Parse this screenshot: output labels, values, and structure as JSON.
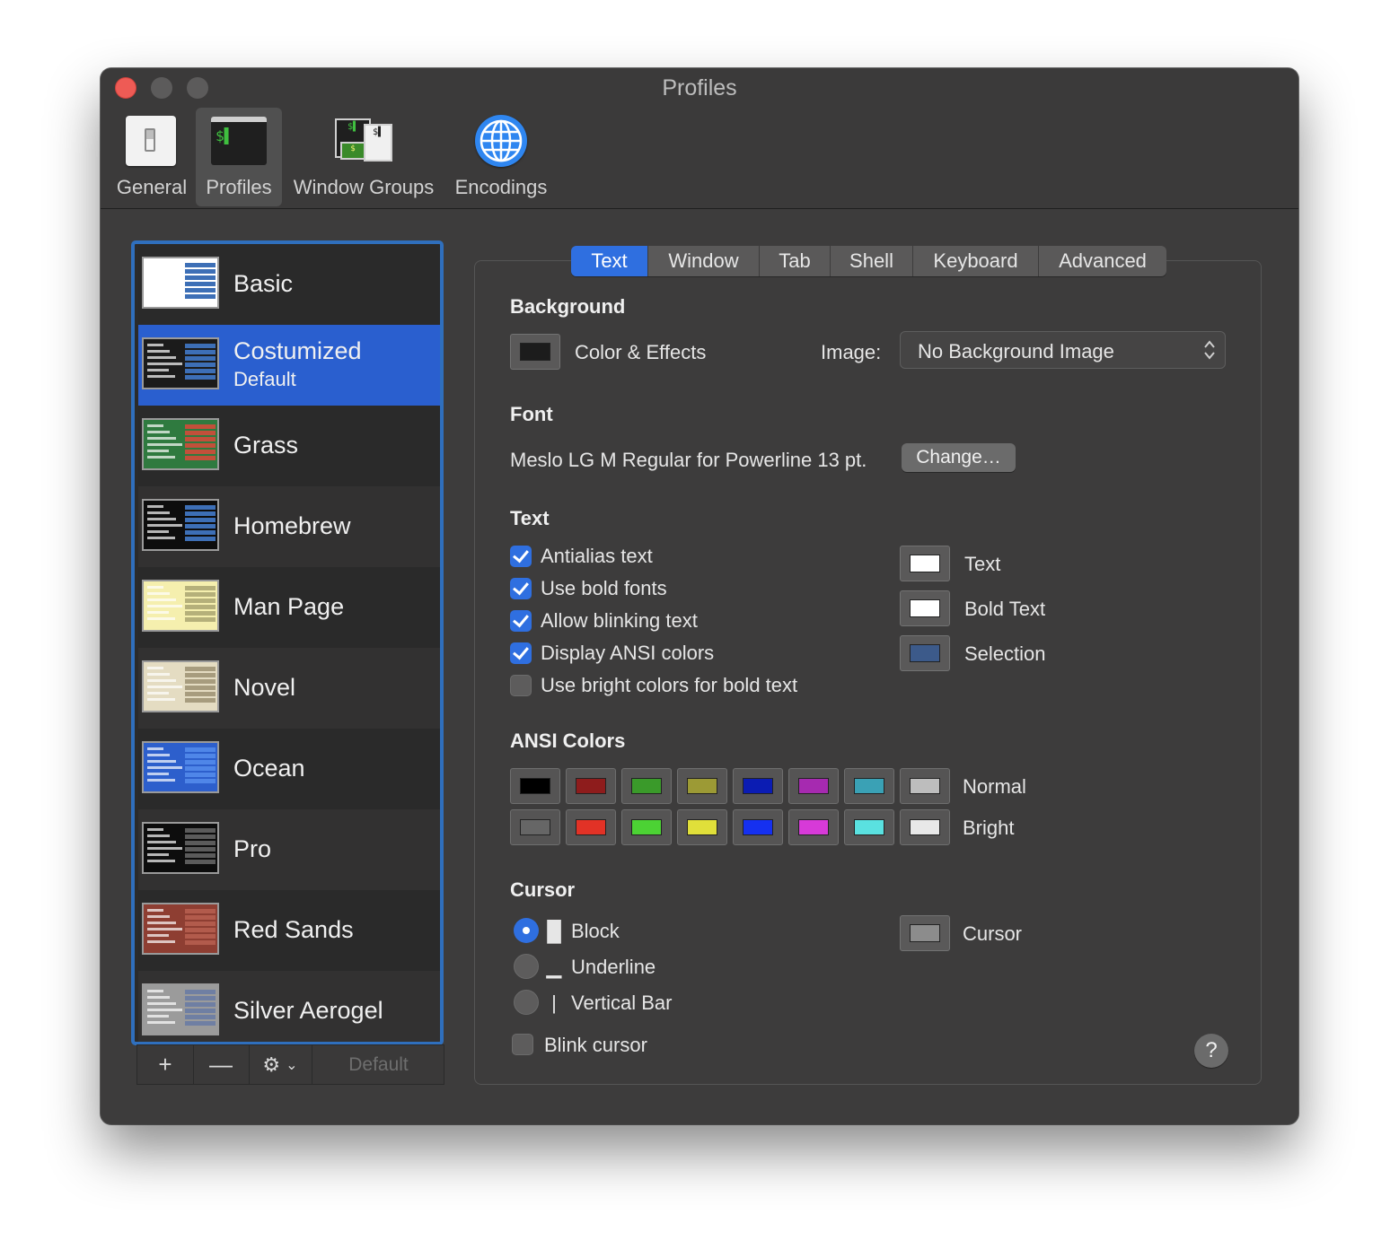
{
  "window": {
    "title": "Profiles",
    "toolbar": [
      {
        "label": "General",
        "icon": "general-switch-icon"
      },
      {
        "label": "Profiles",
        "icon": "terminal-icon"
      },
      {
        "label": "Window Groups",
        "icon": "window-groups-icon"
      },
      {
        "label": "Encodings",
        "icon": "globe-icon"
      }
    ],
    "active_toolbar": "Profiles"
  },
  "profiles": {
    "items": [
      {
        "name": "Basic",
        "thumb_bg": "#ffffff",
        "thumb_bar": "#3d6fb6"
      },
      {
        "name": "Costumized",
        "sub": "Default",
        "selected": true,
        "thumb_bg": "#1b1b1b",
        "thumb_bar": "#3d6fb6"
      },
      {
        "name": "Grass",
        "thumb_bg": "#2f7a3f",
        "thumb_bar": "#c2503a"
      },
      {
        "name": "Homebrew",
        "thumb_bg": "#0d0d0d",
        "thumb_bar": "#3d6fb6"
      },
      {
        "name": "Man Page",
        "thumb_bg": "#f5efae",
        "thumb_bar": "#b5b07a"
      },
      {
        "name": "Novel",
        "thumb_bg": "#e4dcc2",
        "thumb_bar": "#a79c7e"
      },
      {
        "name": "Ocean",
        "thumb_bg": "#2d5fcc",
        "thumb_bar": "#4f86e8"
      },
      {
        "name": "Pro",
        "thumb_bg": "#0d0d0d",
        "thumb_bar": "#5b5b5b"
      },
      {
        "name": "Red Sands",
        "thumb_bg": "#8e3e32",
        "thumb_bar": "#b25b4c"
      },
      {
        "name": "Silver Aerogel",
        "thumb_bg": "#9b9b9b",
        "thumb_bar": "#6f7fa3"
      }
    ],
    "tools": {
      "add": "+",
      "remove": "—",
      "gear": "⚙",
      "default_label": "Default"
    }
  },
  "tabs": {
    "items": [
      "Text",
      "Window",
      "Tab",
      "Shell",
      "Keyboard",
      "Advanced"
    ],
    "active": "Text"
  },
  "background": {
    "heading": "Background",
    "color_effects_label": "Color & Effects",
    "color": "#1c1c1c",
    "image_label": "Image:",
    "image_value": "No Background Image"
  },
  "font": {
    "heading": "Font",
    "value": "Meslo LG M Regular for Powerline 13 pt.",
    "change_label": "Change…"
  },
  "text": {
    "heading": "Text",
    "checkboxes": [
      {
        "label": "Antialias text",
        "checked": true
      },
      {
        "label": "Use bold fonts",
        "checked": true
      },
      {
        "label": "Allow blinking text",
        "checked": true
      },
      {
        "label": "Display ANSI colors",
        "checked": true
      },
      {
        "label": "Use bright colors for bold text",
        "checked": false
      }
    ],
    "colors": [
      {
        "label": "Text",
        "color": "#ffffff"
      },
      {
        "label": "Bold Text",
        "color": "#ffffff"
      },
      {
        "label": "Selection",
        "color": "#3c5a8a"
      }
    ]
  },
  "ansi": {
    "heading": "ANSI Colors",
    "normal_label": "Normal",
    "bright_label": "Bright",
    "normal": [
      "#000000",
      "#8e1c1c",
      "#3a9a2a",
      "#9c9a35",
      "#0b1cb3",
      "#a62ab0",
      "#3aa1b5",
      "#bdbdbd"
    ],
    "bright": [
      "#666666",
      "#e23226",
      "#4cd234",
      "#e0df3a",
      "#1530f0",
      "#d73ad8",
      "#5ae1e0",
      "#e8e8e8"
    ]
  },
  "cursor": {
    "heading": "Cursor",
    "options": [
      {
        "glyph": "█",
        "label": "Block",
        "selected": true
      },
      {
        "glyph": "▁",
        "label": "Underline",
        "selected": false
      },
      {
        "glyph": "|",
        "label": "Vertical Bar",
        "selected": false
      }
    ],
    "blink_label": "Blink cursor",
    "blink_checked": false,
    "color_label": "Cursor",
    "color": "#8c8c8c"
  },
  "help_label": "?"
}
